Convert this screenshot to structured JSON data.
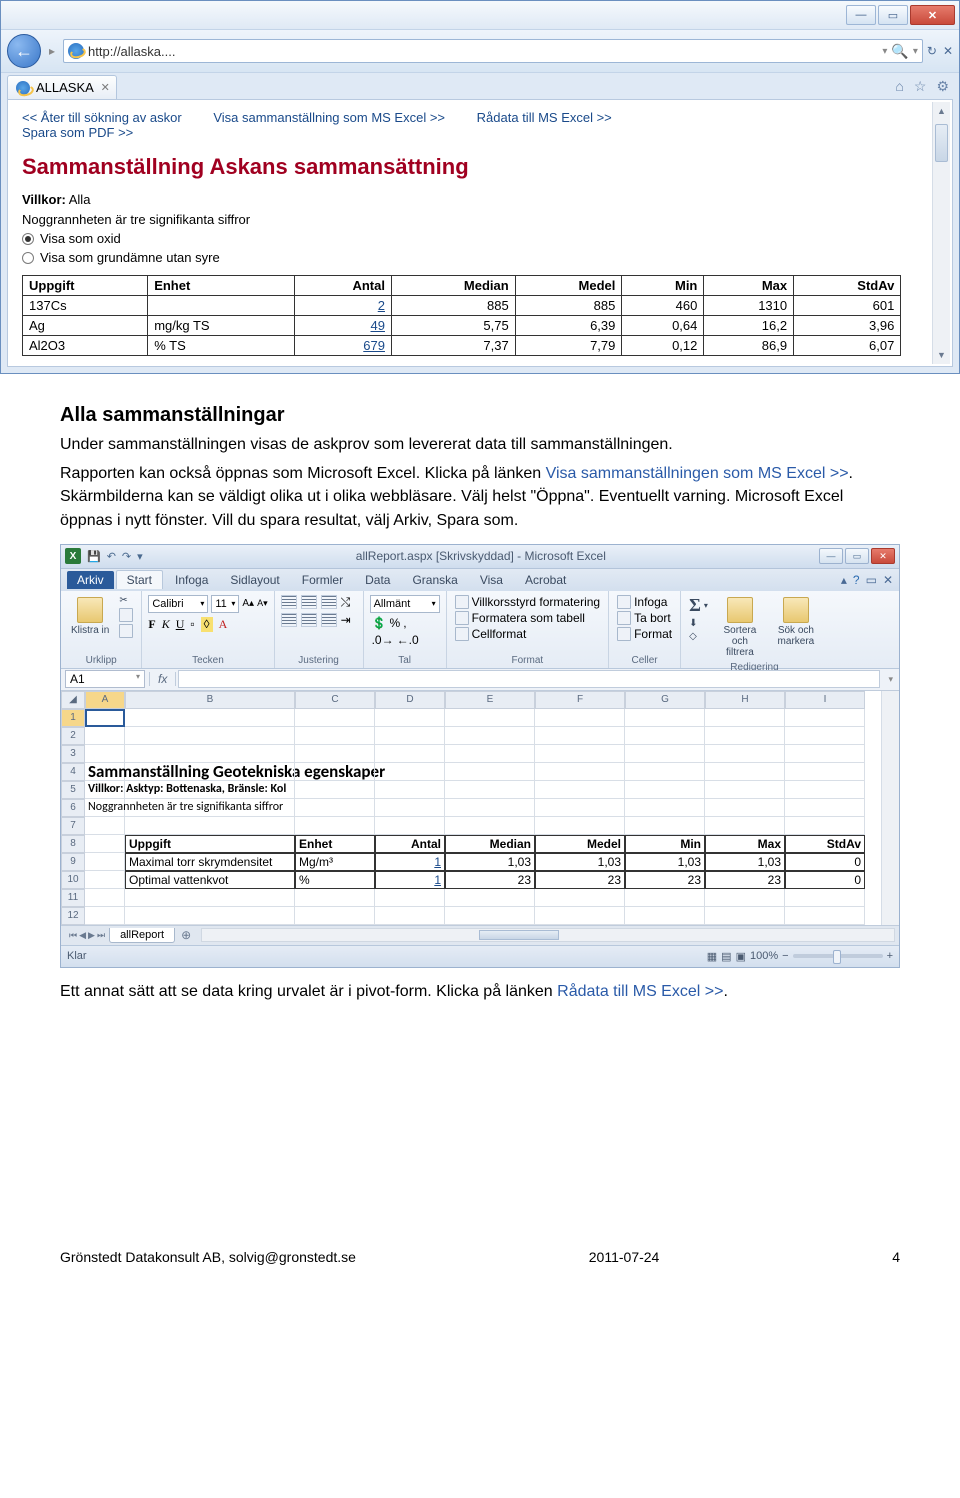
{
  "ie": {
    "url": "http://allaska....",
    "tab_title": "ALLASKA",
    "links": {
      "back_search": "<< Åter till sökning av askor",
      "show_excel": "Visa sammanställning som MS Excel >>",
      "raw_excel": "Rådata till MS Excel >>",
      "save_pdf": "Spara som PDF >>"
    },
    "heading": "Sammanställning Askans sammansättning",
    "villkor_label": "Villkor:",
    "villkor_value": "Alla",
    "noggrannhet": "Noggrannheten är tre signifikanta siffror",
    "radio1": "Visa som oxid",
    "radio2": "Visa som grundämne utan syre",
    "table": {
      "headers": [
        "Uppgift",
        "Enhet",
        "Antal",
        "Median",
        "Medel",
        "Min",
        "Max",
        "StdAv"
      ],
      "rows": [
        {
          "uppgift": "137Cs",
          "enhet": "",
          "antal": "2",
          "median": "885",
          "medel": "885",
          "min": "460",
          "max": "1310",
          "stdav": "601"
        },
        {
          "uppgift": "Ag",
          "enhet": "mg/kg TS",
          "antal": "49",
          "median": "5,75",
          "medel": "6,39",
          "min": "0,64",
          "max": "16,2",
          "stdav": "3,96"
        },
        {
          "uppgift": "Al2O3",
          "enhet": "% TS",
          "antal": "679",
          "median": "7,37",
          "medel": "7,79",
          "min": "0,12",
          "max": "86,9",
          "stdav": "6,07"
        }
      ]
    }
  },
  "doc": {
    "h2": "Alla sammanställningar",
    "p1a": "Under sammanställningen visas de askprov som levererat data till sammanställningen.",
    "p2a": "Rapporten kan också öppnas som Microsoft Excel. Klicka på länken ",
    "p2link": "Visa sammanställningen som MS Excel >>",
    "p2b": ". Skärmbilderna kan se väldigt olika ut i olika webbläsare. Välj helst \"Öppna\". Eventuellt varning. Microsoft Excel öppnas i nytt fönster. Vill du spara resultat, välj Arkiv, Spara som.",
    "p3a": "Ett annat sätt att se data kring urvalet är i pivot-form. Klicka på länken ",
    "p3link": "Rådata till MS Excel >>",
    "p3b": "."
  },
  "excel": {
    "title": "allReport.aspx [Skrivskyddad] - Microsoft Excel",
    "file_tab": "Arkiv",
    "tabs": [
      "Start",
      "Infoga",
      "Sidlayout",
      "Formler",
      "Data",
      "Granska",
      "Visa",
      "Acrobat"
    ],
    "groups": {
      "klistra": "Klistra in",
      "urklipp": "Urklipp",
      "font_name": "Calibri",
      "font_size": "11",
      "tecken": "Tecken",
      "justering": "Justering",
      "allmant": "Allmänt",
      "tal": "Tal",
      "villkor_fmt": "Villkorsstyrd formatering",
      "tabell_fmt": "Formatera som tabell",
      "cellformat": "Cellformat",
      "format_grp": "Format",
      "infoga": "Infoga",
      "tabort": "Ta bort",
      "format_btn": "Format",
      "celler": "Celler",
      "sortera": "Sortera och filtrera",
      "sok": "Sök och markera",
      "redigering": "Redigering"
    },
    "namebox": "A1",
    "sheet_title": "Sammanställning Geotekniska egenskaper",
    "villkor": "Villkor: Asktyp: Bottenaska, Bränsle: Kol",
    "noggrannhet": "Noggrannheten är tre signifikanta siffror",
    "headers": [
      "Uppgift",
      "Enhet",
      "Antal",
      "Median",
      "Medel",
      "Min",
      "Max",
      "StdAv"
    ],
    "rows": [
      {
        "uppgift": "Maximal torr skrymdensitet",
        "enhet": "Mg/m³",
        "antal": "1",
        "median": "1,03",
        "medel": "1,03",
        "min": "1,03",
        "max": "1,03",
        "stdav": "0"
      },
      {
        "uppgift": "Optimal vattenkvot",
        "enhet": "%",
        "antal": "1",
        "median": "23",
        "medel": "23",
        "min": "23",
        "max": "23",
        "stdav": "0"
      }
    ],
    "sheet_tab": "allReport",
    "status": "Klar",
    "zoom": "100%"
  },
  "footer": {
    "left": "Grönstedt Datakonsult AB, solvig@gronstedt.se",
    "center": "2011-07-24",
    "right": "4"
  }
}
